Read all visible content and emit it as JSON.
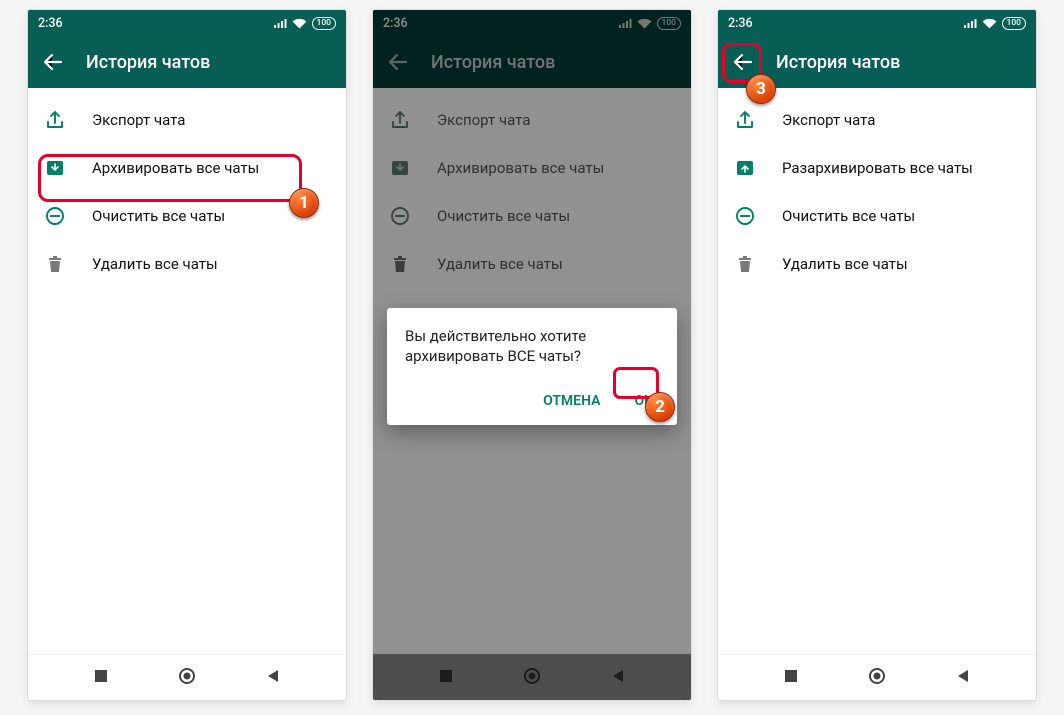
{
  "status": {
    "time": "2:36",
    "battery": "100"
  },
  "header": {
    "title": "История чатов"
  },
  "menu": {
    "export": "Экспорт чата",
    "archive": "Архивировать все чаты",
    "unarchive": "Разархивировать все чаты",
    "clear": "Очистить все чаты",
    "delete": "Удалить все чаты"
  },
  "dialog": {
    "text": "Вы действительно хотите архивировать ВСЕ чаты?",
    "cancel": "ОТМЕНА",
    "ok": "OK"
  },
  "steps": {
    "s1": "1",
    "s2": "2",
    "s3": "3"
  }
}
